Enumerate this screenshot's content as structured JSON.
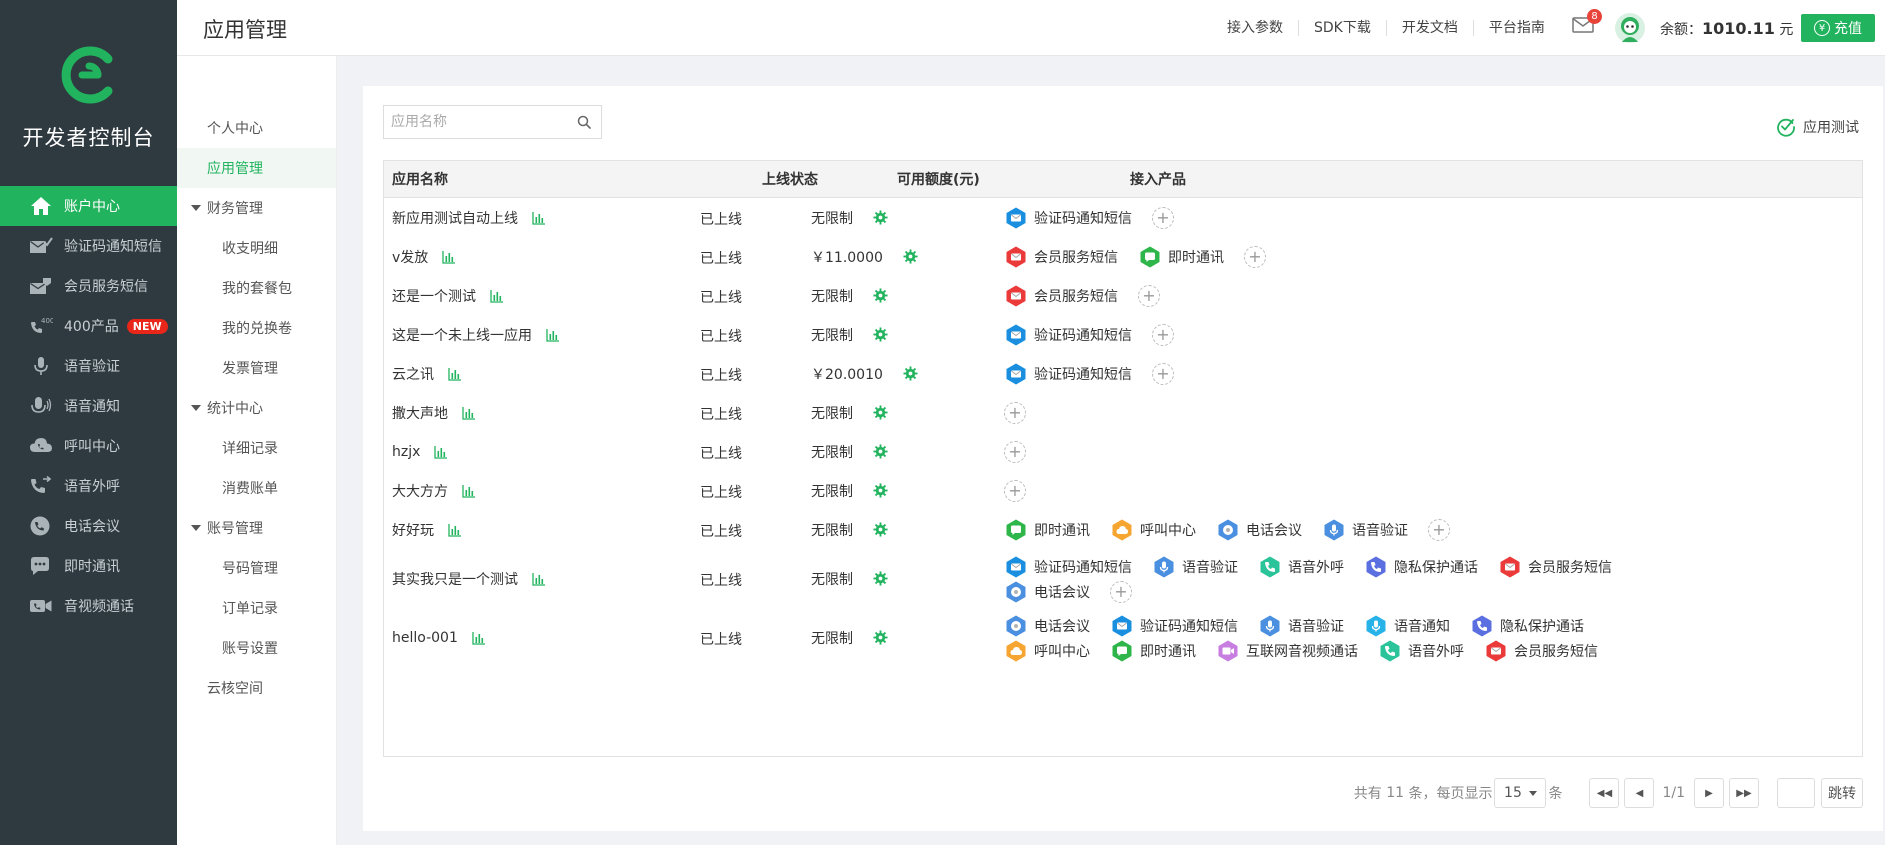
{
  "app": {
    "title": "开发者控制台",
    "accent": "#22b35e"
  },
  "sidebar": {
    "items": [
      {
        "label": "账户中心",
        "icon": "home-icon",
        "active": true
      },
      {
        "label": "验证码通知短信",
        "icon": "sms-check-icon"
      },
      {
        "label": "会员服务短信",
        "icon": "sms-member-icon"
      },
      {
        "label": "400产品",
        "icon": "phone-400-icon",
        "badge": "NEW"
      },
      {
        "label": "语音验证",
        "icon": "mic-check-icon"
      },
      {
        "label": "语音通知",
        "icon": "mic-icon"
      },
      {
        "label": "呼叫中心",
        "icon": "cloud-call-icon"
      },
      {
        "label": "语音外呼",
        "icon": "phone-out-icon"
      },
      {
        "label": "电话会议",
        "icon": "conference-icon"
      },
      {
        "label": "即时通讯",
        "icon": "chat-icon"
      },
      {
        "label": "音视频通话",
        "icon": "video-icon"
      }
    ]
  },
  "header": {
    "page_title": "应用管理",
    "links": [
      "接入参数",
      "SDK下载",
      "开发文档",
      "平台指南"
    ],
    "mail_count": "8",
    "balance_label": "余额：",
    "balance_value": "1010.11",
    "balance_unit": "元",
    "recharge_label": "充值"
  },
  "subnav": {
    "items": [
      {
        "label": "个人中心",
        "level": "l1"
      },
      {
        "label": "应用管理",
        "level": "l1",
        "active": true
      },
      {
        "label": "财务管理",
        "level": "grp"
      },
      {
        "label": "收支明细",
        "level": "l2"
      },
      {
        "label": "我的套餐包",
        "level": "l2"
      },
      {
        "label": "我的兑换卷",
        "level": "l2"
      },
      {
        "label": "发票管理",
        "level": "l2"
      },
      {
        "label": "统计中心",
        "level": "grp"
      },
      {
        "label": "详细记录",
        "level": "l2"
      },
      {
        "label": "消费账单",
        "level": "l2"
      },
      {
        "label": "账号管理",
        "level": "grp"
      },
      {
        "label": "号码管理",
        "level": "l2"
      },
      {
        "label": "订单记录",
        "level": "l2"
      },
      {
        "label": "账号设置",
        "level": "l2"
      },
      {
        "label": "云核空间",
        "level": "l1"
      }
    ]
  },
  "search": {
    "placeholder": "应用名称"
  },
  "app_test_label": "应用测试",
  "table": {
    "headers": [
      "应用名称",
      "上线状态",
      "可用额度(元)",
      "接入产品"
    ],
    "rows": [
      {
        "name": "新应用测试自动上线",
        "status": "已上线",
        "quota": "无限制",
        "products": [
          [
            "sms_verify"
          ]
        ]
      },
      {
        "name": "v发放",
        "status": "已上线",
        "quota": "￥11.0000",
        "products": [
          [
            "sms_member",
            "im"
          ]
        ]
      },
      {
        "name": "还是一个测试",
        "status": "已上线",
        "quota": "无限制",
        "products": [
          [
            "sms_member"
          ]
        ]
      },
      {
        "name": "这是一个未上线一应用",
        "status": "已上线",
        "quota": "无限制",
        "products": [
          [
            "sms_verify"
          ]
        ]
      },
      {
        "name": "云之讯",
        "status": "已上线",
        "quota": "￥20.0010",
        "products": [
          [
            "sms_verify"
          ]
        ]
      },
      {
        "name": "撒大声地",
        "status": "已上线",
        "quota": "无限制",
        "products": [
          []
        ]
      },
      {
        "name": "hzjx",
        "status": "已上线",
        "quota": "无限制",
        "products": [
          []
        ]
      },
      {
        "name": "大大方方",
        "status": "已上线",
        "quota": "无限制",
        "products": [
          []
        ]
      },
      {
        "name": "好好玩",
        "status": "已上线",
        "quota": "无限制",
        "products": [
          [
            "im",
            "call_center",
            "conference",
            "voice_verify"
          ]
        ]
      },
      {
        "name": "其实我只是一个测试",
        "status": "已上线",
        "quota": "无限制",
        "products": [
          [
            "sms_verify",
            "voice_verify",
            "voice_out",
            "privacy",
            "sms_member"
          ],
          [
            "conference"
          ]
        ]
      },
      {
        "name": "hello-001",
        "status": "已上线",
        "quota": "无限制",
        "products": [
          [
            "conference",
            "sms_verify",
            "voice_verify",
            "voice_notify",
            "privacy"
          ],
          [
            "call_center",
            "im",
            "video",
            "voice_out",
            "sms_member"
          ]
        ],
        "no_plus": true
      }
    ]
  },
  "products": {
    "sms_verify": {
      "label": "验证码通知短信",
      "color": "#1a8fe0",
      "icon": "mail-icon"
    },
    "sms_member": {
      "label": "会员服务短信",
      "color": "#ea3a3a",
      "icon": "mail-icon"
    },
    "im": {
      "label": "即时通讯",
      "color": "#2fb64a",
      "icon": "chat-icon"
    },
    "call_center": {
      "label": "呼叫中心",
      "color": "#f5a530",
      "icon": "cloud-icon"
    },
    "conference": {
      "label": "电话会议",
      "color": "#4a8fe0",
      "icon": "conference-icon"
    },
    "voice_verify": {
      "label": "语音验证",
      "color": "#4a8fe0",
      "icon": "mic-icon"
    },
    "voice_out": {
      "label": "语音外呼",
      "color": "#2bc39a",
      "icon": "phone-icon"
    },
    "privacy": {
      "label": "隐私保护通话",
      "color": "#5b6fe0",
      "icon": "phone-icon"
    },
    "voice_notify": {
      "label": "语音通知",
      "color": "#28b3e8",
      "icon": "mic-icon"
    },
    "video": {
      "label": "互联网音视频通话",
      "color": "#c77ee0",
      "icon": "video-icon"
    }
  },
  "pager": {
    "total_prefix": "共有",
    "total": "11",
    "total_mid": "条，每页显示",
    "page_size": "15",
    "total_suffix": "条",
    "page_info": "1/1",
    "jump_label": "跳转"
  }
}
